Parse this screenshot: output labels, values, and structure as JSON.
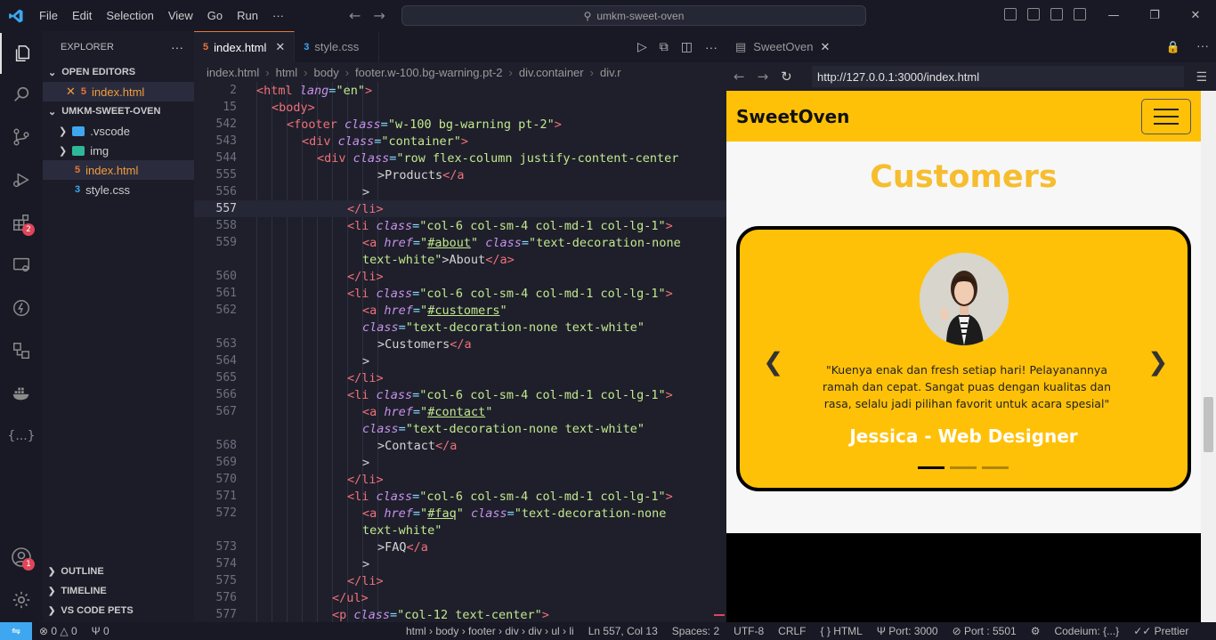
{
  "titlebar": {
    "menu": [
      "File",
      "Edit",
      "Selection",
      "View",
      "Go",
      "Run",
      "···"
    ],
    "search": "umkm-sweet-oven"
  },
  "activity": {
    "extensions_badge": "2",
    "accounts_badge": "1"
  },
  "sidebar": {
    "title": "EXPLORER",
    "open_editors": "OPEN EDITORS",
    "open_file": "index.html",
    "project": "UMKM-SWEET-OVEN",
    "items": [
      ".vscode",
      "img",
      "index.html",
      "style.css"
    ],
    "outline": "OUTLINE",
    "timeline": "TIMELINE",
    "pets": "VS CODE PETS"
  },
  "editor": {
    "tabs": [
      "index.html",
      "style.css"
    ],
    "breadcrumbs": [
      "index.html",
      "html",
      "body",
      "footer.w-100.bg-warning.pt-2",
      "div.container",
      "div.r"
    ]
  },
  "code": [
    {
      "n": "2",
      "i": 0,
      "t": [
        [
          "tag",
          "<html "
        ],
        [
          "attr",
          "lang"
        ],
        [
          "punc",
          "="
        ],
        [
          "str",
          "\"en\""
        ],
        [
          "tag",
          ">"
        ]
      ]
    },
    {
      "n": "15",
      "i": 1,
      "t": [
        [
          "tag",
          "<body>"
        ]
      ]
    },
    {
      "n": "542",
      "i": 2,
      "t": [
        [
          "tag",
          "<footer "
        ],
        [
          "attr",
          "class"
        ],
        [
          "punc",
          "="
        ],
        [
          "str",
          "\"w-100 bg-warning pt-2\""
        ],
        [
          "tag",
          ">"
        ]
      ]
    },
    {
      "n": "543",
      "i": 3,
      "t": [
        [
          "tag",
          "<div "
        ],
        [
          "attr",
          "class"
        ],
        [
          "punc",
          "="
        ],
        [
          "str",
          "\"container\""
        ],
        [
          "tag",
          ">"
        ]
      ]
    },
    {
      "n": "544",
      "i": 4,
      "t": [
        [
          "tag",
          "<div "
        ],
        [
          "attr",
          "class"
        ],
        [
          "punc",
          "="
        ],
        [
          "str",
          "\"row flex-column justify-content-center"
        ]
      ]
    },
    {
      "n": "555",
      "i": 8,
      "t": [
        [
          "plain",
          ">Products"
        ],
        [
          "tag",
          "</a"
        ]
      ]
    },
    {
      "n": "556",
      "i": 7,
      "t": [
        [
          "plain",
          ">"
        ]
      ]
    },
    {
      "n": "557",
      "i": 6,
      "cur": true,
      "t": [
        [
          "tag",
          "</li>"
        ]
      ]
    },
    {
      "n": "558",
      "i": 6,
      "t": [
        [
          "tag",
          "<li "
        ],
        [
          "attr",
          "class"
        ],
        [
          "punc",
          "="
        ],
        [
          "str",
          "\"col-6 col-sm-4 col-md-1 col-lg-1\""
        ],
        [
          "tag",
          ">"
        ]
      ]
    },
    {
      "n": "559",
      "i": 7,
      "t": [
        [
          "tag",
          "<a "
        ],
        [
          "attr",
          "href"
        ],
        [
          "punc",
          "="
        ],
        [
          "str",
          "\""
        ],
        [
          "strul",
          "#about"
        ],
        [
          "str",
          "\" "
        ],
        [
          "attr",
          "class"
        ],
        [
          "punc",
          "="
        ],
        [
          "str",
          "\"text-decoration-none"
        ]
      ]
    },
    {
      "n": "",
      "i": 7,
      "t": [
        [
          "str",
          "text-white\""
        ],
        [
          "plain",
          ">About"
        ],
        [
          "tag",
          "</a>"
        ]
      ]
    },
    {
      "n": "560",
      "i": 6,
      "t": [
        [
          "tag",
          "</li>"
        ]
      ]
    },
    {
      "n": "561",
      "i": 6,
      "t": [
        [
          "tag",
          "<li "
        ],
        [
          "attr",
          "class"
        ],
        [
          "punc",
          "="
        ],
        [
          "str",
          "\"col-6 col-sm-4 col-md-1 col-lg-1\""
        ],
        [
          "tag",
          ">"
        ]
      ]
    },
    {
      "n": "562",
      "i": 7,
      "t": [
        [
          "tag",
          "<a "
        ],
        [
          "attr",
          "href"
        ],
        [
          "punc",
          "="
        ],
        [
          "str",
          "\""
        ],
        [
          "strul",
          "#customers"
        ],
        [
          "str",
          "\""
        ]
      ]
    },
    {
      "n": "",
      "i": 7,
      "t": [
        [
          "attr",
          "class"
        ],
        [
          "punc",
          "="
        ],
        [
          "str",
          "\"text-decoration-none text-white\""
        ]
      ]
    },
    {
      "n": "563",
      "i": 8,
      "t": [
        [
          "plain",
          ">Customers"
        ],
        [
          "tag",
          "</a"
        ]
      ]
    },
    {
      "n": "564",
      "i": 7,
      "t": [
        [
          "plain",
          ">"
        ]
      ]
    },
    {
      "n": "565",
      "i": 6,
      "t": [
        [
          "tag",
          "</li>"
        ]
      ]
    },
    {
      "n": "566",
      "i": 6,
      "t": [
        [
          "tag",
          "<li "
        ],
        [
          "attr",
          "class"
        ],
        [
          "punc",
          "="
        ],
        [
          "str",
          "\"col-6 col-sm-4 col-md-1 col-lg-1\""
        ],
        [
          "tag",
          ">"
        ]
      ]
    },
    {
      "n": "567",
      "i": 7,
      "t": [
        [
          "tag",
          "<a "
        ],
        [
          "attr",
          "href"
        ],
        [
          "punc",
          "="
        ],
        [
          "str",
          "\""
        ],
        [
          "strul",
          "#contact"
        ],
        [
          "str",
          "\""
        ]
      ]
    },
    {
      "n": "",
      "i": 7,
      "t": [
        [
          "attr",
          "class"
        ],
        [
          "punc",
          "="
        ],
        [
          "str",
          "\"text-decoration-none text-white\""
        ]
      ]
    },
    {
      "n": "568",
      "i": 8,
      "t": [
        [
          "plain",
          ">Contact"
        ],
        [
          "tag",
          "</a"
        ]
      ]
    },
    {
      "n": "569",
      "i": 7,
      "t": [
        [
          "plain",
          ">"
        ]
      ]
    },
    {
      "n": "570",
      "i": 6,
      "t": [
        [
          "tag",
          "</li>"
        ]
      ]
    },
    {
      "n": "571",
      "i": 6,
      "t": [
        [
          "tag",
          "<li "
        ],
        [
          "attr",
          "class"
        ],
        [
          "punc",
          "="
        ],
        [
          "str",
          "\"col-6 col-sm-4 col-md-1 col-lg-1\""
        ],
        [
          "tag",
          ">"
        ]
      ]
    },
    {
      "n": "572",
      "i": 7,
      "t": [
        [
          "tag",
          "<a "
        ],
        [
          "attr",
          "href"
        ],
        [
          "punc",
          "="
        ],
        [
          "str",
          "\""
        ],
        [
          "strul",
          "#faq"
        ],
        [
          "str",
          "\" "
        ],
        [
          "attr",
          "class"
        ],
        [
          "punc",
          "="
        ],
        [
          "str",
          "\"text-decoration-none"
        ]
      ]
    },
    {
      "n": "",
      "i": 7,
      "t": [
        [
          "str",
          "text-white\""
        ]
      ]
    },
    {
      "n": "573",
      "i": 8,
      "t": [
        [
          "plain",
          ">FAQ"
        ],
        [
          "tag",
          "</a"
        ]
      ]
    },
    {
      "n": "574",
      "i": 7,
      "t": [
        [
          "plain",
          ">"
        ]
      ]
    },
    {
      "n": "575",
      "i": 6,
      "t": [
        [
          "tag",
          "</li>"
        ]
      ]
    },
    {
      "n": "576",
      "i": 5,
      "t": [
        [
          "tag",
          "</ul>"
        ]
      ]
    },
    {
      "n": "577",
      "i": 5,
      "t": [
        [
          "tag",
          "<p "
        ],
        [
          "attr",
          "class"
        ],
        [
          "punc",
          "="
        ],
        [
          "str",
          "\"col-12 text-center\""
        ],
        [
          "tag",
          ">"
        ]
      ]
    }
  ],
  "preview": {
    "tab_title": "SweetOven",
    "url": "http://127.0.0.1:3000/index.html",
    "brand": "SweetOven",
    "section_title": "Customers",
    "quote": "\"Kuenya enak dan fresh setiap hari! Pelayanannya ramah dan cepat. Sangat puas dengan kualitas dan rasa, selalu jadi pilihan favorit untuk acara spesial\"",
    "person": "Jessica - Web Designer",
    "colors": {
      "brand_yellow": "#ffc107",
      "title_yellow": "#f6bd2e"
    }
  },
  "status": {
    "errors": "0",
    "warnings": "0",
    "ports": "0",
    "path": "html › body › footer › div › div › ul › li",
    "position": "Ln 557, Col 13",
    "spaces": "Spaces: 2",
    "encoding": "UTF-8",
    "eol": "CRLF",
    "language": "HTML",
    "port": "Port: 3000",
    "port2": "Port : 5501",
    "codeium": "Codeium: {...}",
    "prettier": "Prettier"
  }
}
